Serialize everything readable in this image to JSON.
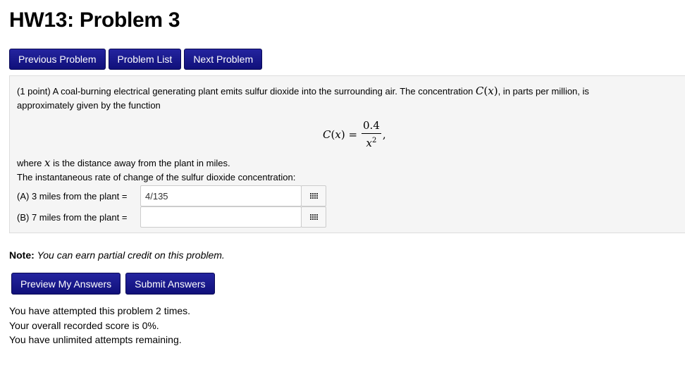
{
  "page": {
    "title": "HW13: Problem 3"
  },
  "nav": {
    "previous": "Previous Problem",
    "list": "Problem List",
    "next": "Next Problem"
  },
  "problem": {
    "points": "(1 point)",
    "intro_1": "A coal-burning electrical generating plant emits sulfur dioxide into the surrounding air. The concentration",
    "func_name": "C",
    "func_var": "x",
    "intro_2": ", in parts per million, is",
    "intro_3": "approximately given by the function",
    "formula": {
      "lhs_name": "C",
      "lhs_var": "x",
      "numerator": "0.4",
      "denominator_var": "x",
      "denominator_exp": "2"
    },
    "where_1": "where",
    "where_var": "x",
    "where_2": "is the distance away from the plant in miles.",
    "rate_text": "The instantaneous rate of change of the sulfur dioxide concentration:",
    "answers": [
      {
        "label": "(A) 3 miles from the plant =",
        "value": "4/135"
      },
      {
        "label": "(B) 7 miles from the plant =",
        "value": ""
      }
    ]
  },
  "note": {
    "label": "Note:",
    "text": "You can earn partial credit on this problem."
  },
  "actions": {
    "preview": "Preview My Answers",
    "submit": "Submit Answers"
  },
  "status": {
    "attempts": "You have attempted this problem 2 times.",
    "score": "Your overall recorded score is 0%.",
    "remaining": "You have unlimited attempts remaining."
  },
  "colors": {
    "button_bg": "#1a1a8f",
    "problem_bg": "#f5f5f5"
  },
  "icons": {
    "equation_editor": "grid-icon"
  }
}
